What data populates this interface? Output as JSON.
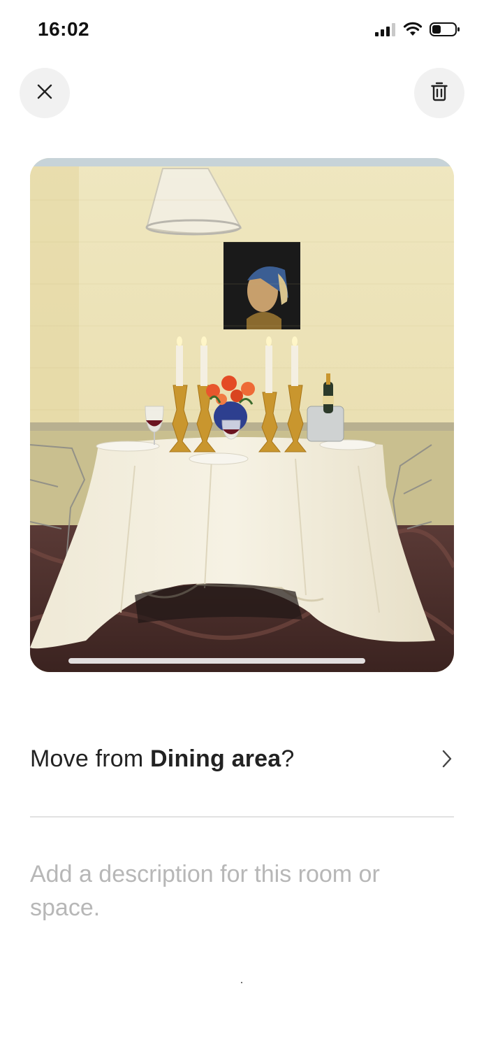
{
  "status_bar": {
    "time": "16:02",
    "icons": [
      "signal-icon",
      "wifi-icon",
      "battery-icon"
    ]
  },
  "toolbar": {
    "close_icon": "close-icon",
    "delete_icon": "trash-icon"
  },
  "photo": {
    "subject": "dining-room-photo"
  },
  "move": {
    "prefix": "Move from ",
    "room": "Dining area",
    "suffix": "?",
    "chevron_icon": "chevron-right-icon"
  },
  "description": {
    "placeholder": "Add a description for this room or space."
  },
  "colors": {
    "text": "#222222",
    "placeholder": "#b7b7b7",
    "button_bg": "#f1f1f1",
    "divider": "#e2e2e2"
  }
}
